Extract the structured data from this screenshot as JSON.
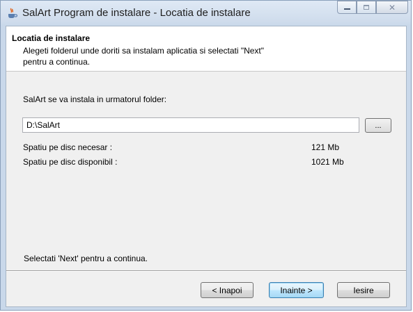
{
  "window": {
    "title": "SalArt Program de instalare - Locatia de instalare"
  },
  "header": {
    "title": "Locatia de instalare",
    "subtitle": "Alegeti folderul unde doriti sa instalam aplicatia si selectati \"Next\" pentru a continua."
  },
  "main": {
    "install_label": "SalArt se va instala in urmatorul folder:",
    "path_value": "D:\\SalArt",
    "browse_label": "...",
    "required_label": "Spatiu pe disc necesar :",
    "required_value": "121 Mb",
    "available_label": "Spatiu pe disc disponibil  :",
    "available_value": "1021 Mb",
    "hint": "Selectati  'Next' pentru a continua."
  },
  "buttons": {
    "back": "< Inapoi",
    "next": "Inainte >",
    "exit": "Iesire"
  },
  "colors": {
    "accent": "#3c7fb1",
    "panel": "#f0f0f0"
  }
}
